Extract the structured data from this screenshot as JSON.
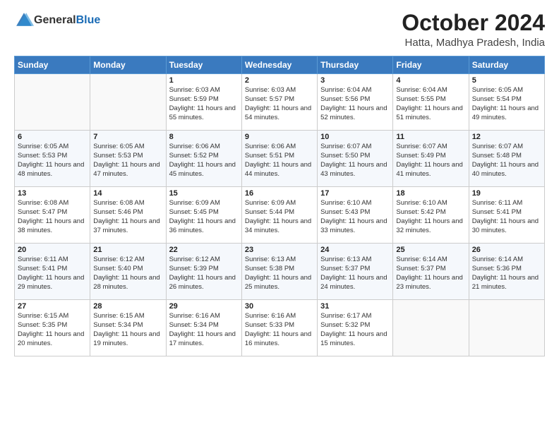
{
  "header": {
    "logo_general": "General",
    "logo_blue": "Blue",
    "month_title": "October 2024",
    "location": "Hatta, Madhya Pradesh, India"
  },
  "days_of_week": [
    "Sunday",
    "Monday",
    "Tuesday",
    "Wednesday",
    "Thursday",
    "Friday",
    "Saturday"
  ],
  "weeks": [
    [
      {
        "day": "",
        "sunrise": "",
        "sunset": "",
        "daylight": ""
      },
      {
        "day": "",
        "sunrise": "",
        "sunset": "",
        "daylight": ""
      },
      {
        "day": "1",
        "sunrise": "Sunrise: 6:03 AM",
        "sunset": "Sunset: 5:59 PM",
        "daylight": "Daylight: 11 hours and 55 minutes."
      },
      {
        "day": "2",
        "sunrise": "Sunrise: 6:03 AM",
        "sunset": "Sunset: 5:57 PM",
        "daylight": "Daylight: 11 hours and 54 minutes."
      },
      {
        "day": "3",
        "sunrise": "Sunrise: 6:04 AM",
        "sunset": "Sunset: 5:56 PM",
        "daylight": "Daylight: 11 hours and 52 minutes."
      },
      {
        "day": "4",
        "sunrise": "Sunrise: 6:04 AM",
        "sunset": "Sunset: 5:55 PM",
        "daylight": "Daylight: 11 hours and 51 minutes."
      },
      {
        "day": "5",
        "sunrise": "Sunrise: 6:05 AM",
        "sunset": "Sunset: 5:54 PM",
        "daylight": "Daylight: 11 hours and 49 minutes."
      }
    ],
    [
      {
        "day": "6",
        "sunrise": "Sunrise: 6:05 AM",
        "sunset": "Sunset: 5:53 PM",
        "daylight": "Daylight: 11 hours and 48 minutes."
      },
      {
        "day": "7",
        "sunrise": "Sunrise: 6:05 AM",
        "sunset": "Sunset: 5:53 PM",
        "daylight": "Daylight: 11 hours and 47 minutes."
      },
      {
        "day": "8",
        "sunrise": "Sunrise: 6:06 AM",
        "sunset": "Sunset: 5:52 PM",
        "daylight": "Daylight: 11 hours and 45 minutes."
      },
      {
        "day": "9",
        "sunrise": "Sunrise: 6:06 AM",
        "sunset": "Sunset: 5:51 PM",
        "daylight": "Daylight: 11 hours and 44 minutes."
      },
      {
        "day": "10",
        "sunrise": "Sunrise: 6:07 AM",
        "sunset": "Sunset: 5:50 PM",
        "daylight": "Daylight: 11 hours and 43 minutes."
      },
      {
        "day": "11",
        "sunrise": "Sunrise: 6:07 AM",
        "sunset": "Sunset: 5:49 PM",
        "daylight": "Daylight: 11 hours and 41 minutes."
      },
      {
        "day": "12",
        "sunrise": "Sunrise: 6:07 AM",
        "sunset": "Sunset: 5:48 PM",
        "daylight": "Daylight: 11 hours and 40 minutes."
      }
    ],
    [
      {
        "day": "13",
        "sunrise": "Sunrise: 6:08 AM",
        "sunset": "Sunset: 5:47 PM",
        "daylight": "Daylight: 11 hours and 38 minutes."
      },
      {
        "day": "14",
        "sunrise": "Sunrise: 6:08 AM",
        "sunset": "Sunset: 5:46 PM",
        "daylight": "Daylight: 11 hours and 37 minutes."
      },
      {
        "day": "15",
        "sunrise": "Sunrise: 6:09 AM",
        "sunset": "Sunset: 5:45 PM",
        "daylight": "Daylight: 11 hours and 36 minutes."
      },
      {
        "day": "16",
        "sunrise": "Sunrise: 6:09 AM",
        "sunset": "Sunset: 5:44 PM",
        "daylight": "Daylight: 11 hours and 34 minutes."
      },
      {
        "day": "17",
        "sunrise": "Sunrise: 6:10 AM",
        "sunset": "Sunset: 5:43 PM",
        "daylight": "Daylight: 11 hours and 33 minutes."
      },
      {
        "day": "18",
        "sunrise": "Sunrise: 6:10 AM",
        "sunset": "Sunset: 5:42 PM",
        "daylight": "Daylight: 11 hours and 32 minutes."
      },
      {
        "day": "19",
        "sunrise": "Sunrise: 6:11 AM",
        "sunset": "Sunset: 5:41 PM",
        "daylight": "Daylight: 11 hours and 30 minutes."
      }
    ],
    [
      {
        "day": "20",
        "sunrise": "Sunrise: 6:11 AM",
        "sunset": "Sunset: 5:41 PM",
        "daylight": "Daylight: 11 hours and 29 minutes."
      },
      {
        "day": "21",
        "sunrise": "Sunrise: 6:12 AM",
        "sunset": "Sunset: 5:40 PM",
        "daylight": "Daylight: 11 hours and 28 minutes."
      },
      {
        "day": "22",
        "sunrise": "Sunrise: 6:12 AM",
        "sunset": "Sunset: 5:39 PM",
        "daylight": "Daylight: 11 hours and 26 minutes."
      },
      {
        "day": "23",
        "sunrise": "Sunrise: 6:13 AM",
        "sunset": "Sunset: 5:38 PM",
        "daylight": "Daylight: 11 hours and 25 minutes."
      },
      {
        "day": "24",
        "sunrise": "Sunrise: 6:13 AM",
        "sunset": "Sunset: 5:37 PM",
        "daylight": "Daylight: 11 hours and 24 minutes."
      },
      {
        "day": "25",
        "sunrise": "Sunrise: 6:14 AM",
        "sunset": "Sunset: 5:37 PM",
        "daylight": "Daylight: 11 hours and 23 minutes."
      },
      {
        "day": "26",
        "sunrise": "Sunrise: 6:14 AM",
        "sunset": "Sunset: 5:36 PM",
        "daylight": "Daylight: 11 hours and 21 minutes."
      }
    ],
    [
      {
        "day": "27",
        "sunrise": "Sunrise: 6:15 AM",
        "sunset": "Sunset: 5:35 PM",
        "daylight": "Daylight: 11 hours and 20 minutes."
      },
      {
        "day": "28",
        "sunrise": "Sunrise: 6:15 AM",
        "sunset": "Sunset: 5:34 PM",
        "daylight": "Daylight: 11 hours and 19 minutes."
      },
      {
        "day": "29",
        "sunrise": "Sunrise: 6:16 AM",
        "sunset": "Sunset: 5:34 PM",
        "daylight": "Daylight: 11 hours and 17 minutes."
      },
      {
        "day": "30",
        "sunrise": "Sunrise: 6:16 AM",
        "sunset": "Sunset: 5:33 PM",
        "daylight": "Daylight: 11 hours and 16 minutes."
      },
      {
        "day": "31",
        "sunrise": "Sunrise: 6:17 AM",
        "sunset": "Sunset: 5:32 PM",
        "daylight": "Daylight: 11 hours and 15 minutes."
      },
      {
        "day": "",
        "sunrise": "",
        "sunset": "",
        "daylight": ""
      },
      {
        "day": "",
        "sunrise": "",
        "sunset": "",
        "daylight": ""
      }
    ]
  ]
}
